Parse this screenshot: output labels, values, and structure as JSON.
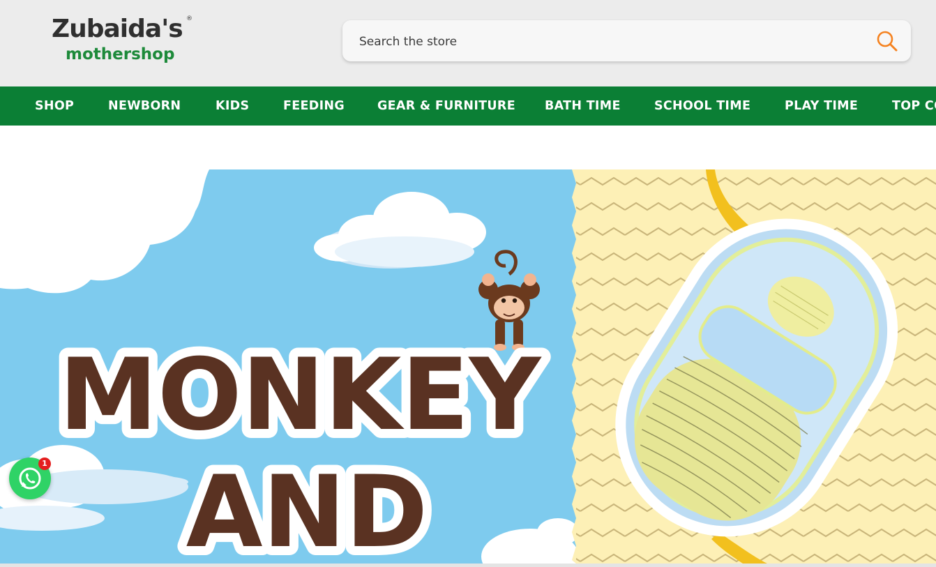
{
  "logo": {
    "brand_top": "Zubaida's",
    "registered": "®",
    "brand_bottom": "mothershop"
  },
  "search": {
    "placeholder": "Search the store",
    "icon": "search-icon"
  },
  "nav": {
    "items": [
      {
        "label": "SHOP"
      },
      {
        "label": "NEWBORN"
      },
      {
        "label": "KIDS"
      },
      {
        "label": "FEEDING"
      },
      {
        "label": "GEAR & FURNITURE"
      },
      {
        "label": "BATH TIME"
      },
      {
        "label": "SCHOOL TIME"
      },
      {
        "label": "PLAY TIME"
      },
      {
        "label": "TOP CO"
      }
    ]
  },
  "banner": {
    "line1": "MONKEY",
    "line2": "AND"
  },
  "whatsapp": {
    "icon": "whatsapp-icon",
    "badge_count": "1"
  },
  "colors": {
    "nav_bg": "#0b7f35",
    "brand_orange": "#f5821f",
    "brand_green": "#1d8a3a",
    "sky": "#7ecbee",
    "banner_yellow": "#fdf0b6",
    "title_brown": "#5a3222",
    "whatsapp": "#2fd366"
  }
}
